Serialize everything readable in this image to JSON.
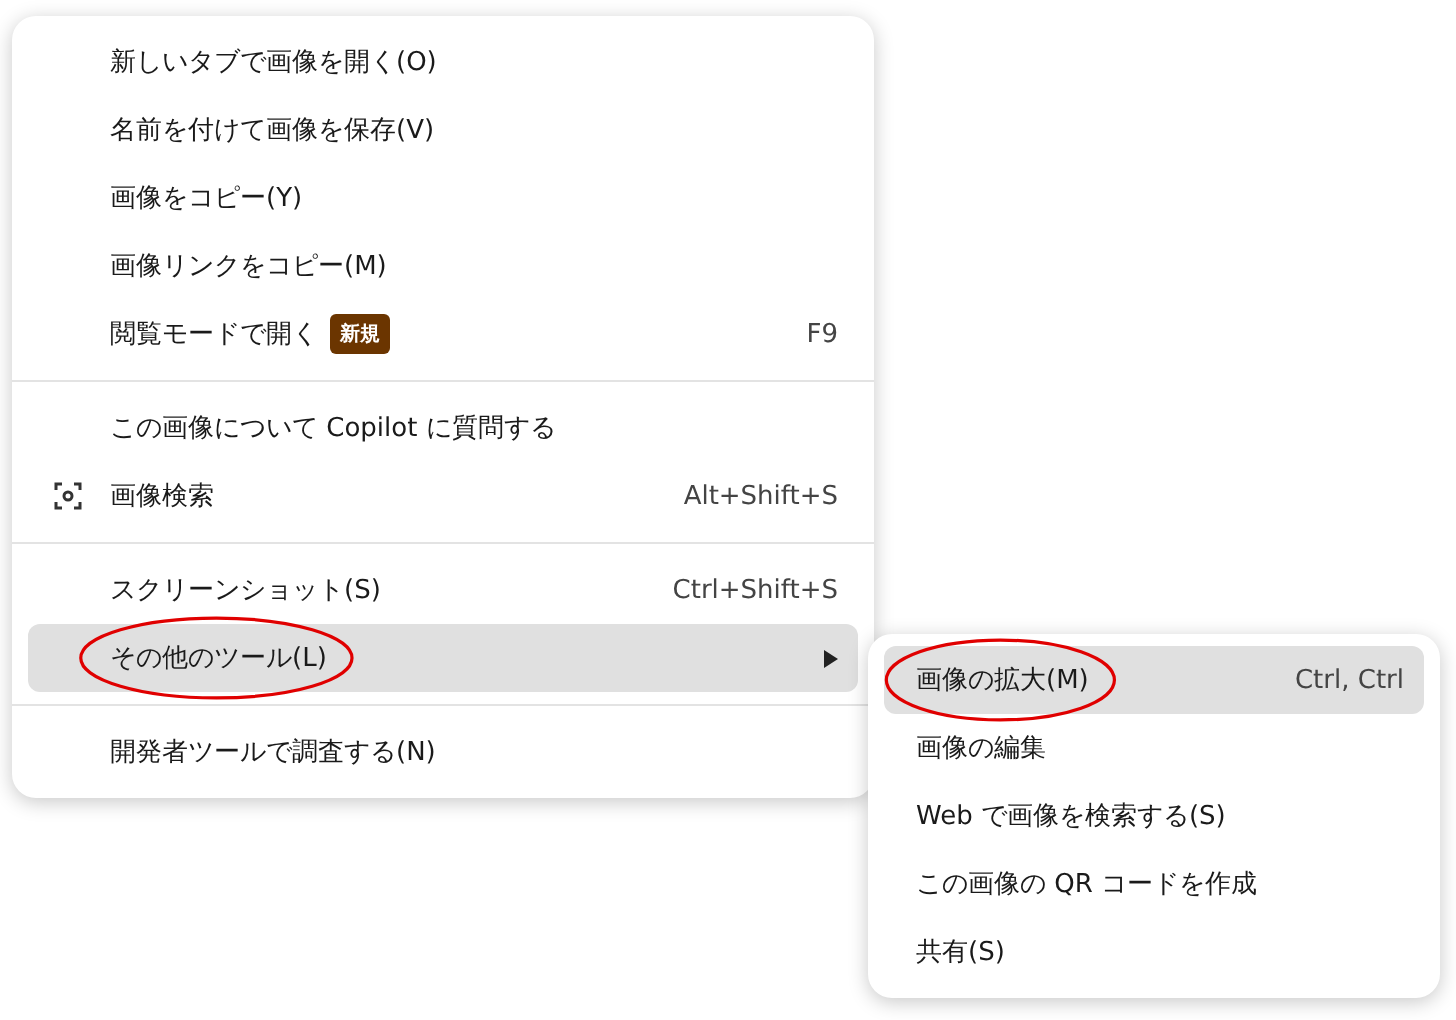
{
  "context_menu": {
    "items": [
      {
        "kind": "item",
        "label": "新しいタブで画像を開く(O)",
        "highlighted": false,
        "circled": false
      },
      {
        "kind": "item",
        "label": "名前を付けて画像を保存(V)",
        "highlighted": false,
        "circled": false
      },
      {
        "kind": "item",
        "label": "画像をコピー(Y)",
        "highlighted": false,
        "circled": false
      },
      {
        "kind": "item",
        "label": "画像リンクをコピー(M)",
        "highlighted": false,
        "circled": false
      },
      {
        "kind": "item",
        "label": "閲覧モードで開く",
        "badge": "新規",
        "shortcut": "F9",
        "highlighted": false,
        "circled": false
      },
      {
        "kind": "separator"
      },
      {
        "kind": "item",
        "label": "この画像について Copilot に質問する",
        "highlighted": false,
        "circled": false
      },
      {
        "kind": "icon-item",
        "label": "画像検索",
        "shortcut": "Alt+Shift+S",
        "highlighted": false,
        "circled": false
      },
      {
        "kind": "separator"
      },
      {
        "kind": "item",
        "label": "スクリーンショット(S)",
        "shortcut": "Ctrl+Shift+S",
        "highlighted": false,
        "circled": false
      },
      {
        "kind": "item",
        "label": "その他のツール(L)",
        "submenu": true,
        "highlighted": true,
        "circled": true
      },
      {
        "kind": "separator"
      },
      {
        "kind": "item",
        "label": "開発者ツールで調査する(N)",
        "highlighted": false,
        "circled": false
      }
    ]
  },
  "submenu": {
    "items": [
      {
        "kind": "item",
        "label": "画像の拡大(M)",
        "shortcut": "Ctrl, Ctrl",
        "highlighted": true,
        "circled": true
      },
      {
        "kind": "item",
        "label": "画像の編集",
        "highlighted": false,
        "circled": false
      },
      {
        "kind": "item",
        "label": "Web で画像を検索する(S)",
        "highlighted": false,
        "circled": false
      },
      {
        "kind": "item",
        "label": "この画像の QR コードを作成",
        "highlighted": false,
        "circled": false
      },
      {
        "kind": "item",
        "label": "共有(S)",
        "highlighted": false,
        "circled": false
      }
    ]
  }
}
